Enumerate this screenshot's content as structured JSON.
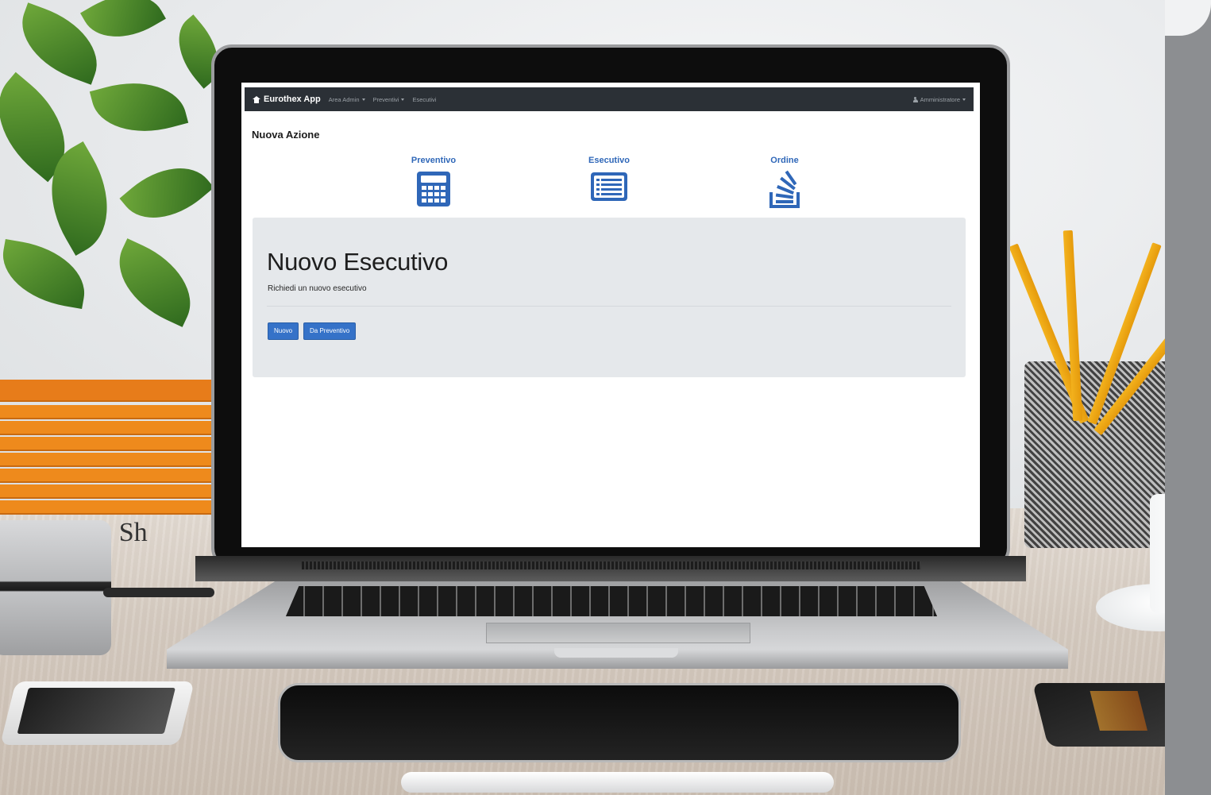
{
  "scene": {
    "book_label": "siness Sh"
  },
  "navbar": {
    "brand": "Eurothex App",
    "items": [
      {
        "label": "Area Admin"
      },
      {
        "label": "Preventivi"
      },
      {
        "label": "Esecutivi"
      }
    ],
    "user": "Amministratore"
  },
  "page": {
    "section_title": "Nuova Azione",
    "actions": [
      {
        "label": "Preventivo",
        "icon": "calculator-icon"
      },
      {
        "label": "Esecutivo",
        "icon": "list-icon"
      },
      {
        "label": "Ordine",
        "icon": "stack-overflow-icon"
      }
    ]
  },
  "jumbotron": {
    "title": "Nuovo Esecutivo",
    "lead": "Richiedi un nuovo esecutivo",
    "buttons": {
      "nuovo": "Nuovo",
      "da_preventivo": "Da Preventivo"
    }
  },
  "colors": {
    "navbar_bg": "#2b3036",
    "accent_blue": "#3572c8",
    "jumbotron_bg": "#e5e8eb"
  }
}
